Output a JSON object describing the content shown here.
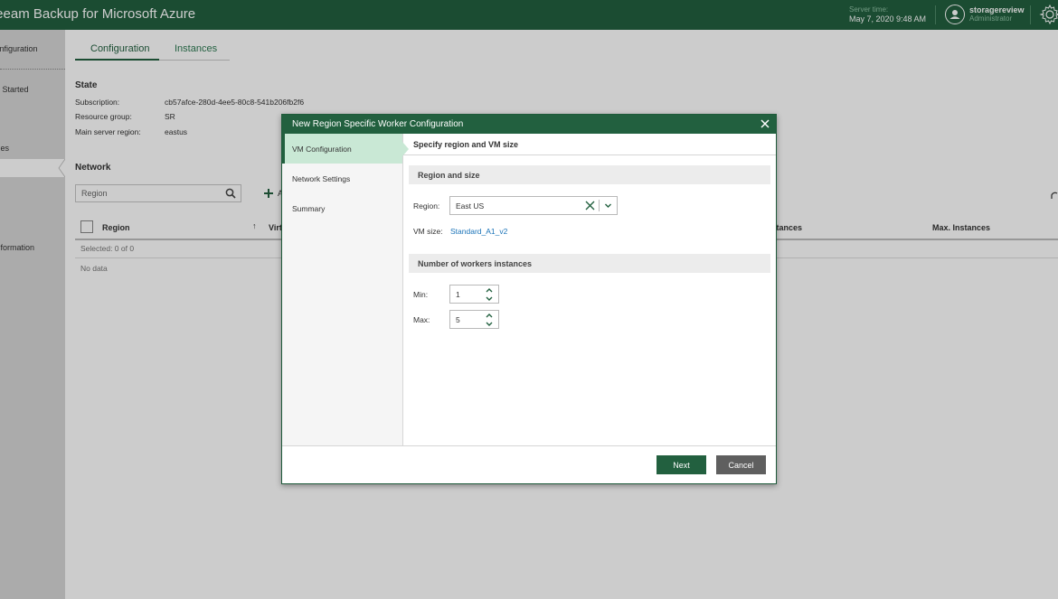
{
  "app": {
    "title": "Veeam Backup for Microsoft Azure",
    "server_time_label": "Server time:",
    "server_time": "May 7, 2020 9:48 AM",
    "user_name": "storagereview",
    "user_role": "Administrator"
  },
  "sidebar": {
    "items": [
      {
        "label": "Configuration"
      },
      {
        "label": "Getting Started"
      },
      {
        "label": "Policies"
      },
      {
        "label": ""
      },
      {
        "label": "Information"
      }
    ]
  },
  "tabs": [
    {
      "label": "Configuration",
      "active": true
    },
    {
      "label": "Instances",
      "active": false
    }
  ],
  "state": {
    "title": "State",
    "subscription_label": "Subscription:",
    "subscription": "cb57afce-280d-4ee5-80c8-541b206fb2f6",
    "resource_group_label": "Resource group:",
    "resource_group": "SR",
    "main_region_label": "Main server region:",
    "main_region": "eastus"
  },
  "network": {
    "title": "Network",
    "search_placeholder": "Region",
    "add_label": "Add",
    "columns": [
      "Region",
      "Virtual network",
      "Min. Instances",
      "Max. Instances"
    ],
    "selected_text": "Selected: 0 of 0",
    "empty_text": "No data"
  },
  "dialog": {
    "title": "New Region Specific Worker Configuration",
    "steps": [
      {
        "label": "VM Configuration",
        "active": true
      },
      {
        "label": "Network Settings",
        "active": false
      },
      {
        "label": "Summary",
        "active": false
      }
    ],
    "header": "Specify region and VM size",
    "group_region": "Region and size",
    "region_label": "Region:",
    "region_value": "East US",
    "vmsize_label": "VM size:",
    "vmsize_value": "Standard_A1_v2",
    "group_workers": "Number of workers instances",
    "min_label": "Min:",
    "min_value": "1",
    "max_label": "Max:",
    "max_value": "5",
    "next_label": "Next",
    "cancel_label": "Cancel"
  },
  "colors": {
    "brand": "#22603f",
    "active_step": "#c9e8d5",
    "link": "#1a73b8"
  }
}
